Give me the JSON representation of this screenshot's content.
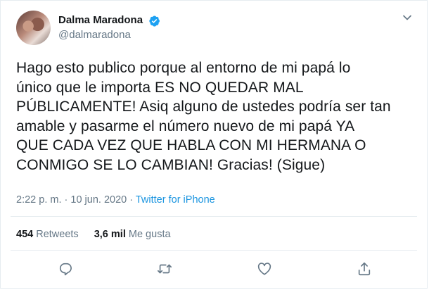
{
  "user": {
    "display_name": "Dalma Maradona",
    "handle": "@dalmaradona"
  },
  "tweet": {
    "text": "Hago esto publico porque al entorno de mi papá lo\núnico que le importa ES NO QUEDAR MAL\nPÚBLICAMENTE! Asiq alguno de ustedes podría ser tan\namable y pasarme el número nuevo de mi papá YA\nQUE CADA VEZ QUE HABLA CON MI HERMANA O\nCONMIGO SE LO CAMBIAN! Gracias! (Sigue)",
    "time": "2:22 p. m.",
    "separator": "·",
    "date": "10 jun. 2020",
    "source": "Twitter for iPhone"
  },
  "stats": {
    "retweets_count": "454",
    "retweets_label": "Retweets",
    "likes_count": "3,6 mil",
    "likes_label": "Me gusta"
  },
  "colors": {
    "text": "#14171a",
    "secondary": "#657786",
    "link": "#1b95e0",
    "verified": "#1da1f2",
    "border": "#e6ecf0"
  },
  "icons": {
    "verified": "verified-badge-icon",
    "menu": "chevron-down-icon",
    "reply": "reply-icon",
    "retweet": "retweet-icon",
    "like": "heart-icon",
    "share": "share-icon"
  }
}
